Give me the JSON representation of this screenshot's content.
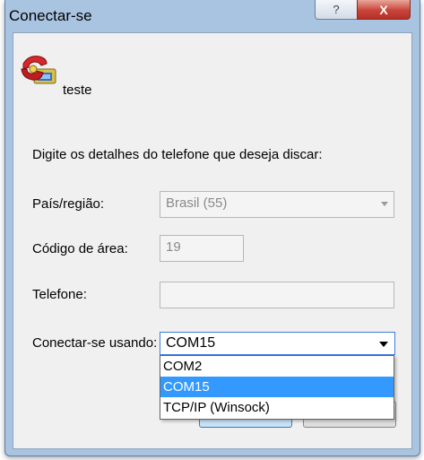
{
  "window": {
    "title": "Conectar-se",
    "help_glyph": "?",
    "close_glyph": "X"
  },
  "connection": {
    "icon": "red-telephone-icon",
    "name": "teste"
  },
  "form": {
    "instructions": "Digite os detalhes do telefone que deseja discar:",
    "country": {
      "label": "País/região:",
      "value": "Brasil (55)"
    },
    "area_code": {
      "label": "Código de área:",
      "value": "19"
    },
    "phone": {
      "label": "Telefone:",
      "value": ""
    },
    "connect_using": {
      "label": "Conectar-se usando:",
      "value": "COM15",
      "options": [
        "COM2",
        "COM15",
        "TCP/IP (Winsock)"
      ],
      "highlighted": "COM15"
    }
  },
  "colors": {
    "highlight": "#3399ff",
    "frame": "#a9c4e1",
    "close_button": "#c8453a"
  }
}
